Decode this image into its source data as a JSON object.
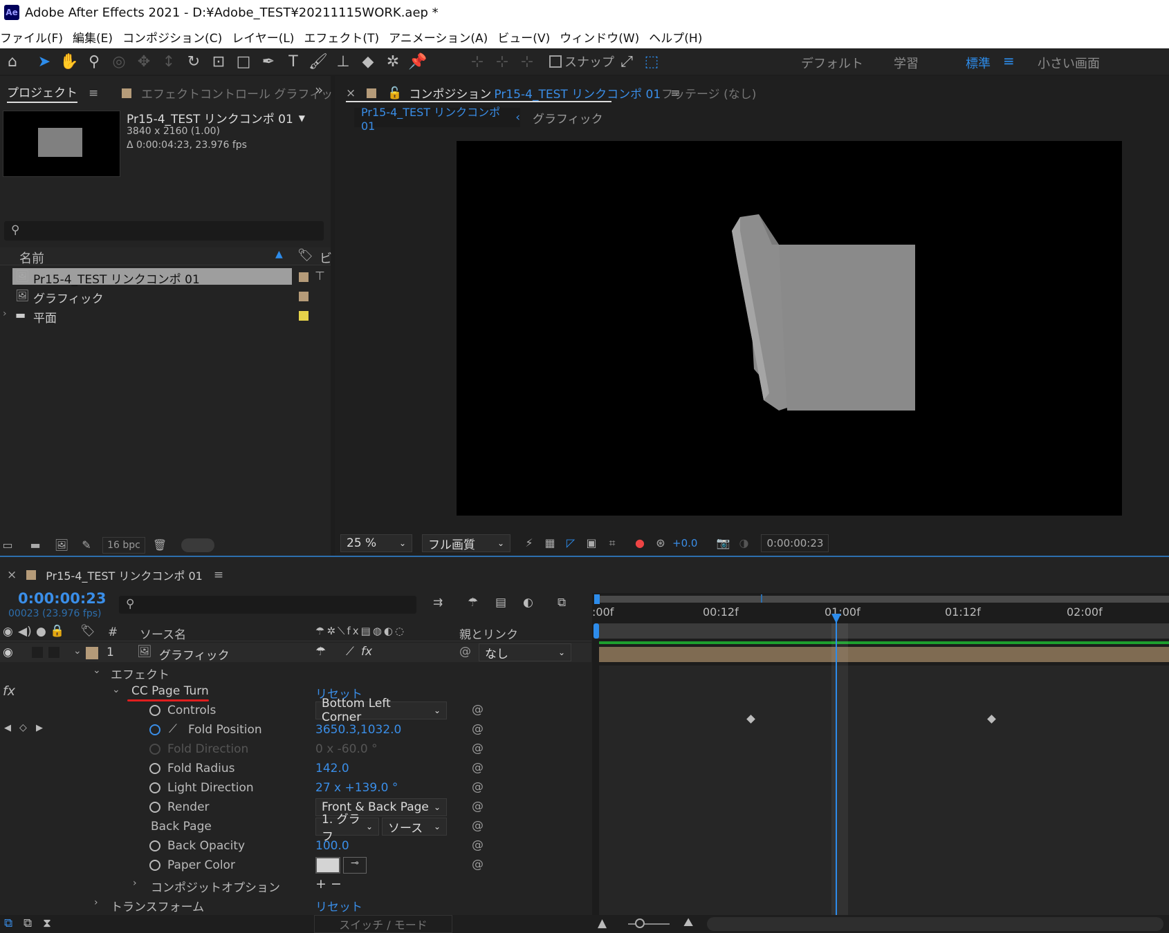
{
  "window": {
    "title": "Adobe After Effects 2021 - D:¥Adobe_TEST¥20211115WORK.aep *",
    "logo": "Ae"
  },
  "menu": [
    "ファイル(F)",
    "編集(E)",
    "コンポジション(C)",
    "レイヤー(L)",
    "エフェクト(T)",
    "アニメーション(A)",
    "ビュー(V)",
    "ウィンドウ(W)",
    "ヘルプ(H)"
  ],
  "toolbar": {
    "snap_label": "スナップ",
    "workspaces": [
      "デフォルト",
      "学習",
      "標準",
      "小さい画面"
    ],
    "active_workspace": "標準"
  },
  "project": {
    "tab_project": "プロジェクト",
    "tab_effect_controls": "エフェクトコントロール グラフィッ",
    "preview_name": "Pr15-4_TEST リンクコンポ 01",
    "preview_dims": "3840 x 2160 (1.00)",
    "preview_duration": "Δ 0:00:04:23, 23.976 fps",
    "col_name": "名前",
    "col_type": "ビ",
    "items": [
      {
        "name": "Pr15-4_TEST リンクコンポ 01",
        "color": "#b59b79",
        "selected": true
      },
      {
        "name": "グラフィック",
        "color": "#b59b79",
        "selected": false
      },
      {
        "name": "平面",
        "color": "#e6d34a",
        "selected": false
      }
    ],
    "bpc": "16 bpc"
  },
  "composition": {
    "tab_prefix": "コンポジション",
    "tab_name": "Pr15-4_TEST リンクコンポ 01",
    "footage_tab": "フッテージ (なし)",
    "crumb_active": "Pr15-4_TEST リンクコンポ 01",
    "crumb_next": "グラフィック",
    "zoom": "25 %",
    "quality": "フル画質",
    "exposure": "+0.0",
    "timecode": "0:00:00:23"
  },
  "timeline": {
    "tab_name": "Pr15-4_TEST リンクコンポ 01",
    "current_time": "0:00:00:23",
    "frames": "00023 (23.976 fps)",
    "col_hash": "#",
    "col_source": "ソース名",
    "col_parent": "親とリンク",
    "ruler": [
      ":00f",
      "00:12f",
      "01:00f",
      "01:12f",
      "02:00f"
    ],
    "layer": {
      "index": "1",
      "name": "グラフィック",
      "parent": "なし"
    },
    "effects_label": "エフェクト",
    "effect_name": "CC Page Turn",
    "reset": "リセット",
    "props": [
      {
        "name": "Controls",
        "value": "Bottom Left Corner",
        "type": "dropdown"
      },
      {
        "name": "Fold Position",
        "value": "3650.3,1032.0",
        "type": "value",
        "animated": true
      },
      {
        "name": "Fold Direction",
        "value": "0 x -60.0 °",
        "type": "disabled"
      },
      {
        "name": "Fold Radius",
        "value": "142.0",
        "type": "value"
      },
      {
        "name": "Light Direction",
        "value": "27 x +139.0 °",
        "type": "value"
      },
      {
        "name": "Render",
        "value": "Front & Back Page",
        "type": "dropdown"
      },
      {
        "name": "Back Page",
        "value": "1. グラフ",
        "value2": "ソース",
        "type": "dual"
      },
      {
        "name": "Back Opacity",
        "value": "100.0",
        "type": "value"
      },
      {
        "name": "Paper Color",
        "value": "",
        "type": "color"
      }
    ],
    "composite_options": "コンポジットオプション",
    "transform": "トランスフォーム",
    "switch_mode": "スイッチ / モード"
  }
}
